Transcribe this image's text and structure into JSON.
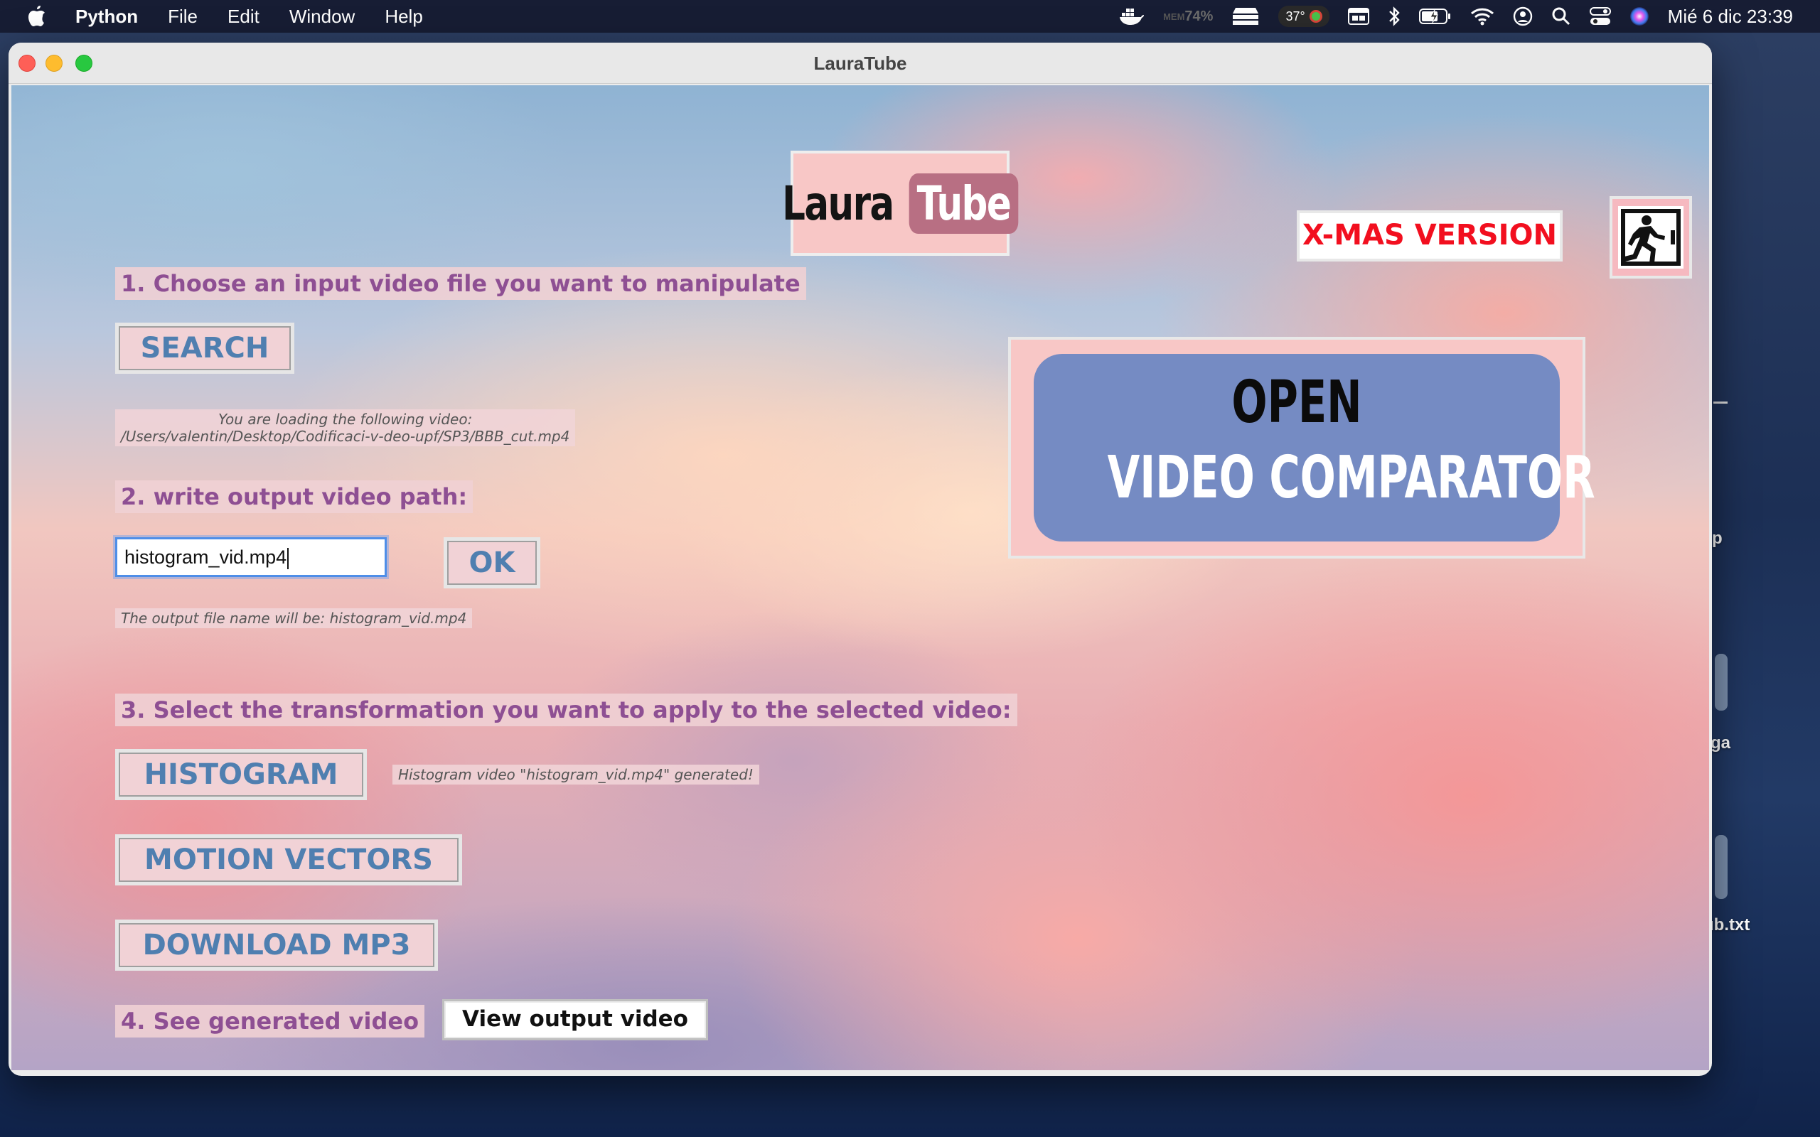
{
  "menubar": {
    "app_name": "Python",
    "menus": [
      "File",
      "Edit",
      "Window",
      "Help"
    ],
    "mem_label": "MEM",
    "mem_value": "74%",
    "temperature": "37°",
    "clock": "Mié 6 dic  23:39"
  },
  "window": {
    "title": "LauraTube"
  },
  "logo": {
    "part1": "Laura",
    "part2": "Tube"
  },
  "xmas_label": "X-MAS VERSION",
  "step1": {
    "label": "1. Choose an input video file you want to manipulate",
    "search_button": "SEARCH",
    "loading_line1": "You are loading the following video:",
    "loading_line2": "/Users/valentin/Desktop/Codificaci-v-deo-upf/SP3/BBB_cut.mp4"
  },
  "step2": {
    "label": "2. write output video path:",
    "input_value": "histogram_vid.mp4",
    "ok_button": "OK",
    "output_info": "The output file name will be: histogram_vid.mp4"
  },
  "step3": {
    "label": "3. Select the transformation you want to apply to the selected video:",
    "histogram_button": "HISTOGRAM",
    "histogram_status": "Histogram video \"histogram_vid.mp4\" generated!",
    "motion_button": "MOTION VECTORS",
    "mp3_button": "DOWNLOAD MP3"
  },
  "step4": {
    "label": "4. See generated video",
    "view_button": "View output video"
  },
  "comparator": {
    "line1": "OPEN",
    "line2": "VIDEO COMPARATOR"
  },
  "desktop": {
    "peek1": "p",
    "peek2": "ga",
    "peek3": "ub.txt"
  },
  "colors": {
    "label_text": "#8e4f93",
    "button_text": "#4f7fb0",
    "xmas_red": "#f20f1f",
    "comparator_blue": "#758bc3",
    "logo_pink": "#f8c7c6"
  }
}
